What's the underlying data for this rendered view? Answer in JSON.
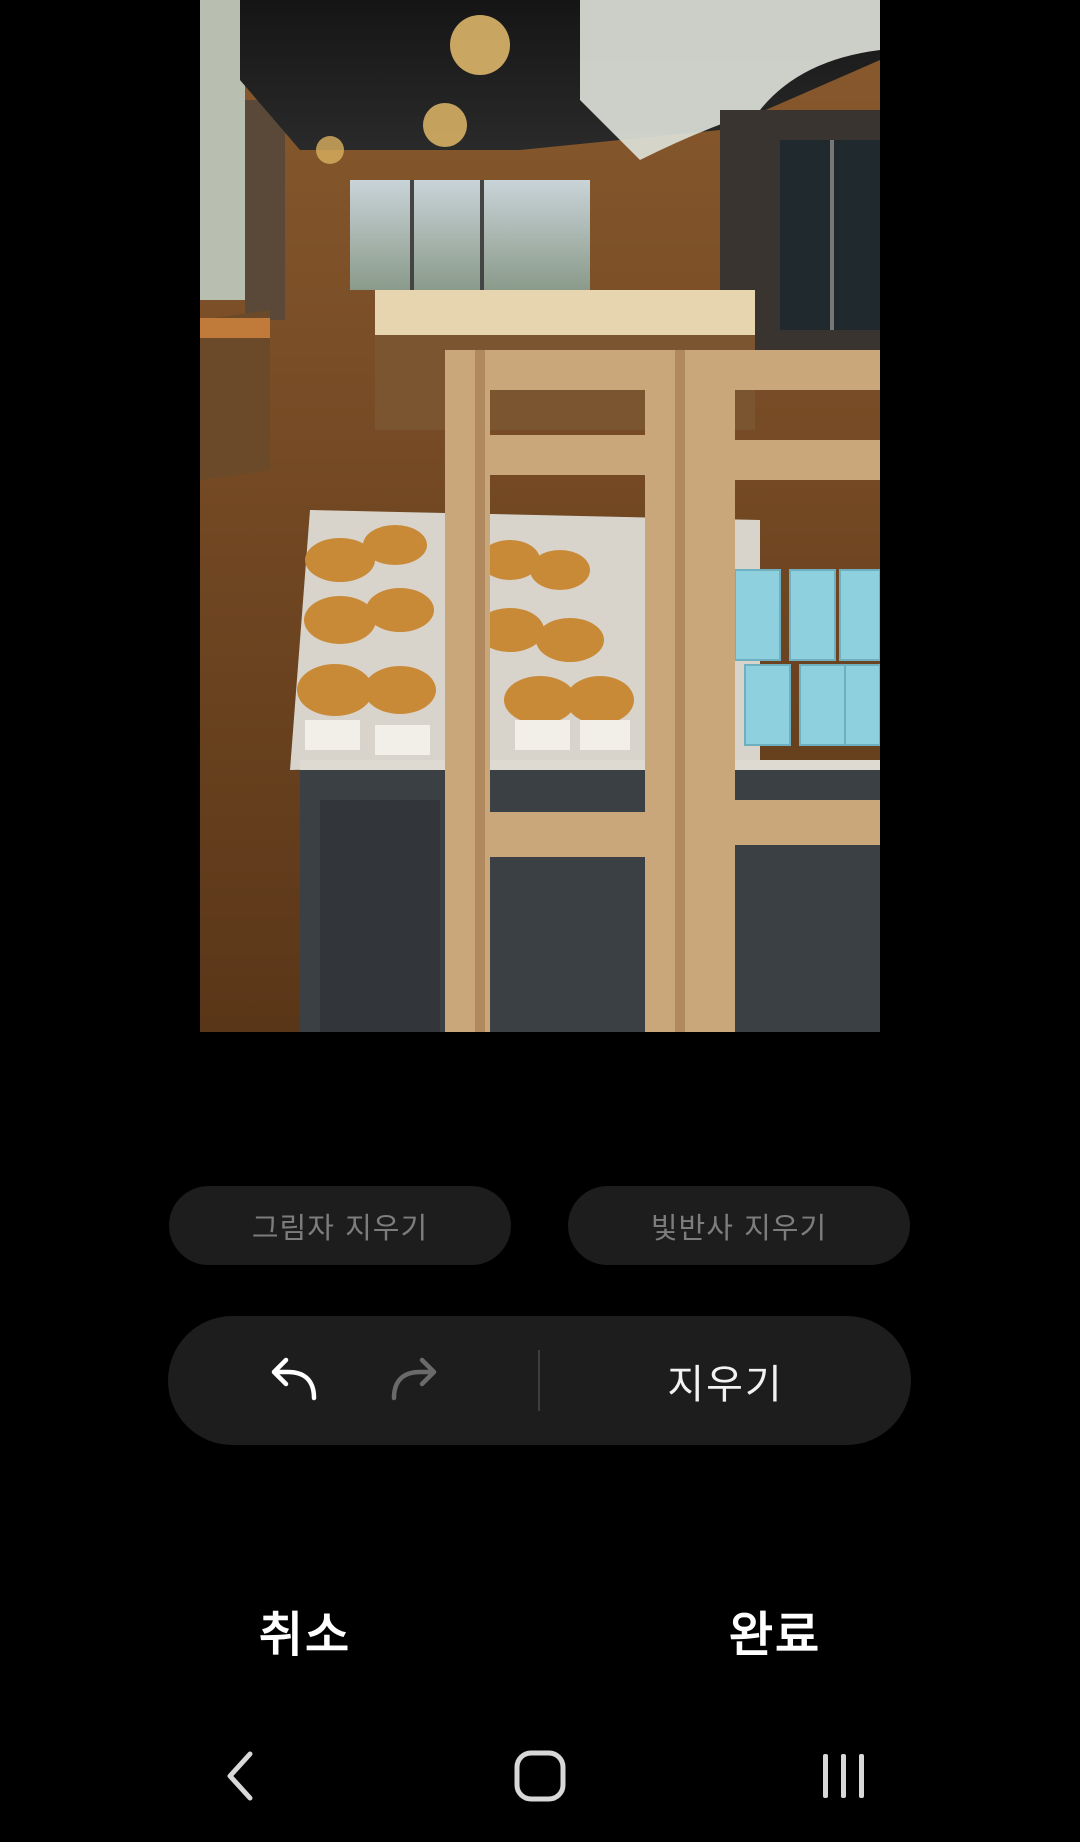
{
  "editor": {
    "photo_label": "Bakery interior photo",
    "options": {
      "shadow_label": "그림자 지우기",
      "reflection_label": "빛반사 지우기"
    },
    "toolbar": {
      "undo_icon": "undo-arrow",
      "redo_icon": "redo-arrow",
      "erase_label": "지우기"
    },
    "actions": {
      "cancel_label": "취소",
      "done_label": "완료"
    }
  },
  "navbar": {
    "back_icon": "chevron-left",
    "home_icon": "rounded-square",
    "recent_icon": "three-bars"
  }
}
